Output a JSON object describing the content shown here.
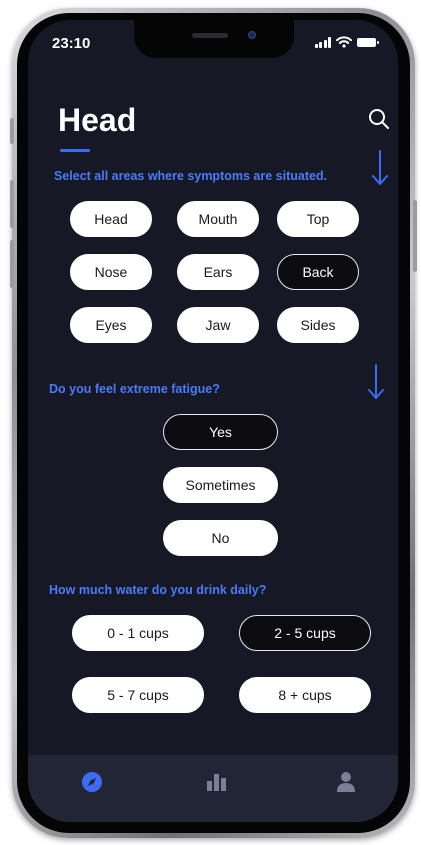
{
  "status_bar": {
    "time": "23:10"
  },
  "header": {
    "title": "Head"
  },
  "questions": {
    "areas": {
      "text": "Select all areas where symptoms are situated.",
      "options": [
        {
          "label": "Head",
          "selected": false
        },
        {
          "label": "Mouth",
          "selected": false
        },
        {
          "label": "Top",
          "selected": false
        },
        {
          "label": "Nose",
          "selected": false
        },
        {
          "label": "Ears",
          "selected": false
        },
        {
          "label": "Back",
          "selected": true
        },
        {
          "label": "Eyes",
          "selected": false
        },
        {
          "label": "Jaw",
          "selected": false
        },
        {
          "label": "Sides",
          "selected": false
        }
      ]
    },
    "fatigue": {
      "text": "Do you feel extreme fatigue?",
      "options": [
        {
          "label": "Yes",
          "selected": true
        },
        {
          "label": "Sometimes",
          "selected": false
        },
        {
          "label": "No",
          "selected": false
        }
      ]
    },
    "water": {
      "text": "How much water do you drink daily?",
      "options": [
        {
          "label": "0 - 1 cups",
          "selected": false
        },
        {
          "label": "2 - 5 cups",
          "selected": true
        },
        {
          "label": "5 - 7 cups",
          "selected": false
        },
        {
          "label": "8 + cups",
          "selected": false
        }
      ]
    }
  },
  "tab_bar": {
    "tabs": [
      {
        "icon": "compass-icon",
        "active": true
      },
      {
        "icon": "bar-chart-icon",
        "active": false
      },
      {
        "icon": "user-icon",
        "active": false
      }
    ]
  },
  "colors": {
    "accent": "#3d6cf0",
    "question_text": "#4a7bf7",
    "screen_background": "#161826",
    "tab_bar_background": "#222536"
  }
}
